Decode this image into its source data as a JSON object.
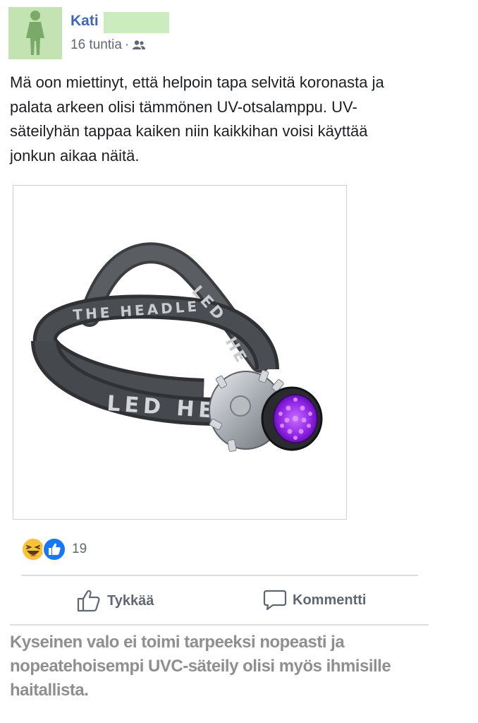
{
  "post": {
    "author": "Kati",
    "time": "16 tuntia",
    "separator": "·",
    "audience_icon": "friends-icon",
    "text": "Mä oon miettinyt, että helpoin tapa selvitä koronasta ja palata arkeen olisi tämmönen UV-otsalamppu. UV-säteilyhän tappaa kaiken niin kaikkihan voisi käyttää jonkun aikaa näitä."
  },
  "image": {
    "strap_text_top": "THE HEADLE",
    "strap_text_bottom": "LED HE",
    "strap_text_upper": "LED",
    "strap_text_side": "HE",
    "uv_color": "#9b27f0"
  },
  "reactions": {
    "icons": [
      "haha-emoji-icon",
      "like-icon"
    ],
    "count": "19"
  },
  "actions": {
    "like_label": "Tykkää",
    "comment_label": "Kommentti"
  },
  "fact_check": {
    "text": "Kyseinen valo ei toimi tarpeeksi nopeasti ja nopeatehoisempi UVC-säteily olisi myös ihmisille haitallista."
  },
  "colors": {
    "link_blue": "#4267b2",
    "avatar_bg": "#c4e3b3",
    "muted_text": "#606770",
    "caption_gray": "#8f8f8f"
  }
}
